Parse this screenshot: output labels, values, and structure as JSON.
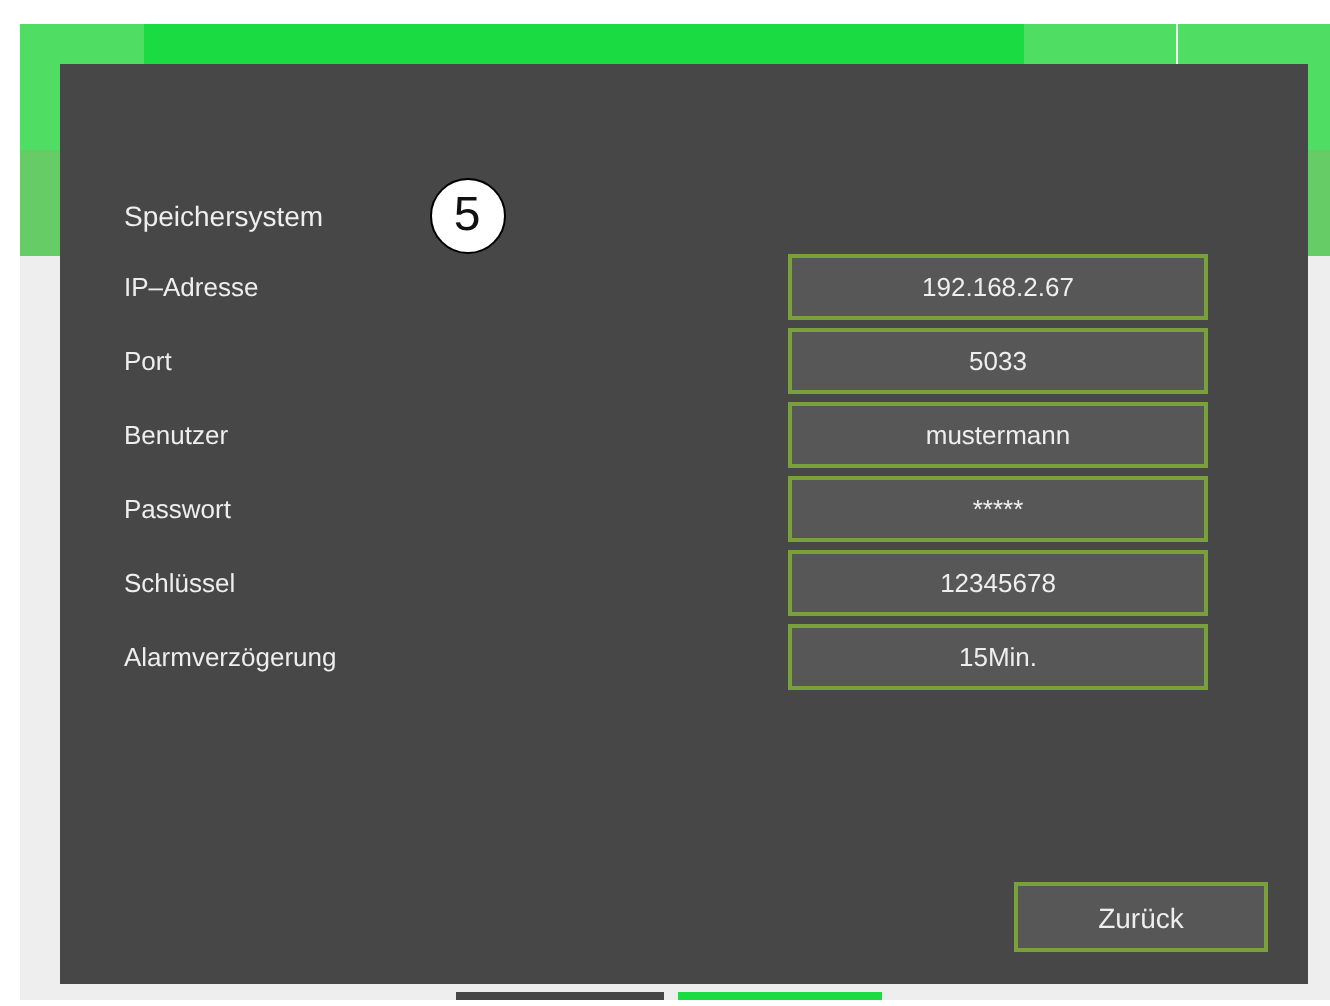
{
  "header_tabs": [
    {
      "selected": false
    },
    {
      "selected": true
    },
    {
      "selected": false
    },
    {
      "selected": false
    }
  ],
  "bottom_tabs": [
    {
      "selected": false
    },
    {
      "selected": true
    }
  ],
  "dialog": {
    "title": "Speichersystem",
    "annotation_marker": "5",
    "fields": [
      {
        "label": "IP–Adresse",
        "value": "192.168.2.67"
      },
      {
        "label": "Port",
        "value": "5033"
      },
      {
        "label": "Benutzer",
        "value": "mustermann"
      },
      {
        "label": "Passwort",
        "value": "*****"
      },
      {
        "label": "Schlüssel",
        "value": "12345678"
      },
      {
        "label": "Alarmverzögerung",
        "value": "15Min."
      }
    ],
    "buttons": [
      "Zurück"
    ]
  }
}
